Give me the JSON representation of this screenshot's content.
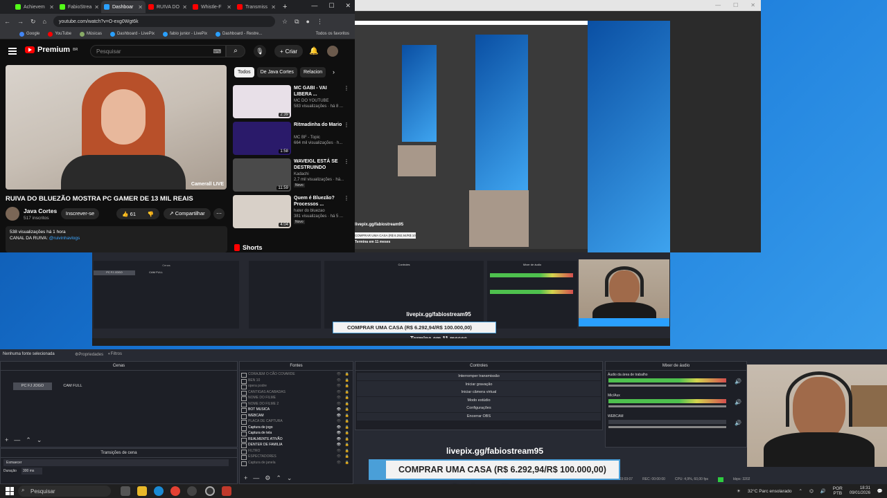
{
  "chrome": {
    "tabs": [
      {
        "label": "Achievem",
        "color": "#53fc18"
      },
      {
        "label": "FabioStrea",
        "color": "#53fc18"
      },
      {
        "label": "Dashboar",
        "color": "#2aa0ff"
      },
      {
        "label": "RUIVA DO",
        "color": "#ff0000"
      },
      {
        "label": "Whistle-F",
        "color": "#ff0000"
      },
      {
        "label": "Transmiss",
        "color": "#ff0000"
      }
    ],
    "url": "youtube.com/watch?v=O-exg0Wgt6k",
    "bookmarks": [
      "Google",
      "YouTube",
      "Músicas",
      "Dashboard - LivePix",
      "fabio junior - LivePix",
      "Dashboard - Restre..."
    ],
    "all_bookmarks": "Todos os favoritos"
  },
  "youtube": {
    "logo": "Premium",
    "logo_sup": "BR",
    "search_placeholder": "Pesquisar",
    "create_label": "Criar",
    "video_watermark": "Camerall LIVE",
    "title": "RUIVA DO BLUEZÃO MOSTRA PC GAMER DE 13 MIL REAIS",
    "channel": "Java Cortes",
    "subscribers": "517 inscritos",
    "subscribe": "Inscrever-se",
    "likes": "61",
    "share": "Compartilhar",
    "desc_line1": "538 visualizações  há 1 hora",
    "desc_line2_label": "CANAL DA RUIVA: ",
    "desc_line2_link": "@ruivinhavlogs",
    "chips": [
      "Todos",
      "De Java Cortes",
      "Relacion"
    ],
    "recs": [
      {
        "title": "MC GABI - VAI LIBERA ...",
        "channel": "MC DO YOUTUBE",
        "meta": "583 visualizações · há 8 ...",
        "dur": "2:39",
        "color": "#e8e0e8"
      },
      {
        "title": "Ritmadinha do Mario",
        "channel": "MC BF - Topic",
        "meta": "664 mil visualizações · h...",
        "dur": "1:58",
        "color": "#2a1a6a"
      },
      {
        "title": "WAVEIGL ESTÁ SE DESTRUINDO",
        "channel": "Kadachi",
        "meta": "2,7 mil visualizações · há...",
        "dur": "11:59",
        "color": "#4a4a4a",
        "badge": "Novo"
      },
      {
        "title": "Quem é Bluezão? Processos ...",
        "channel": "hater do bluezao",
        "meta": "381 visualizações · há 5 ...",
        "dur": "4:04",
        "color": "#d8d0c8",
        "badge": "Novo"
      }
    ],
    "shorts": "Shorts"
  },
  "obs": {
    "no_source": "Nenhuma fonte selecionada",
    "properties": "Propriedades",
    "filters": "Filtros",
    "scenes_header": "Cenas",
    "scenes": [
      "PC FJ JOGO",
      "CAM FULL"
    ],
    "sources_header": "Fontes",
    "sources": [
      {
        "name": "CORAJEM O CÃO COVARDE",
        "vis": false
      },
      {
        "name": "BEN 10",
        "vis": false
      },
      {
        "name": "opera podre",
        "vis": false
      },
      {
        "name": "CANTIGAS ACABADAS",
        "vis": false
      },
      {
        "name": "NOME DO FILME",
        "vis": false
      },
      {
        "name": "NOME DO FILME 2",
        "vis": false
      },
      {
        "name": "BOT MUSICA",
        "vis": true
      },
      {
        "name": "WEBCAM",
        "vis": true
      },
      {
        "name": "PLACA DE CAPTURA",
        "vis": false
      },
      {
        "name": "Captura de jogo",
        "vis": true
      },
      {
        "name": "Captura de tela",
        "vis": true
      },
      {
        "name": "REALMENTE ATIVÃO",
        "vis": true
      },
      {
        "name": "DENTER DE FAMILIA",
        "vis": true
      },
      {
        "name": "FILTRO",
        "vis": false
      },
      {
        "name": "ESPECTADORES",
        "vis": false
      },
      {
        "name": "Captura de janela",
        "vis": false
      }
    ],
    "controls_header": "Controles",
    "controls": [
      "Interromper transmissão",
      "Iniciar gravação",
      "Iniciar câmera virtual",
      "Modo estúdio",
      "Configurações",
      "Encerrar OBS"
    ],
    "mixer_header": "Mixer de áudio",
    "mixer": [
      "Áudio da área de trabalho",
      "Mic/Aux",
      "WEBCAM"
    ],
    "transitions_header": "Transições de cena",
    "transition": "Esmaecer",
    "duration_label": "Duração",
    "duration": "300 ms",
    "status": [
      "LIVE: 03:03:07",
      "REC: 00:00:00",
      "CPU: 4,9%, 60,00 fps",
      "kbps: 3202"
    ]
  },
  "overlay": {
    "pix_url": "livepix.gg/fabiostream95",
    "goal_text": "COMPRAR UMA CASA (R$ 6.292,94/R$ 100.000,00)",
    "goal_fraction": 0.063,
    "goal_sub": "Termina em 11 meses"
  },
  "taskbar": {
    "search": "Pesquisar",
    "weather": "32°C  Parc ensolarado",
    "lang1": "POR",
    "lang2": "PTB",
    "time": "18:31",
    "date": "09/01/2026"
  }
}
